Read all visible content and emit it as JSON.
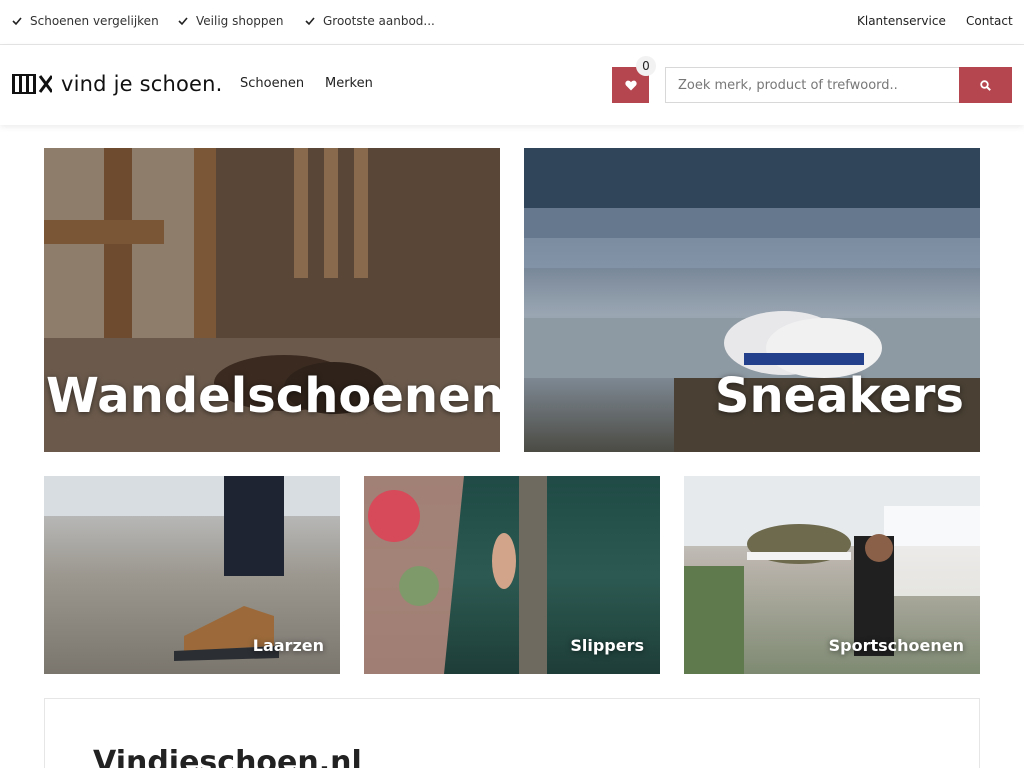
{
  "topbar": {
    "usps": [
      "Schoenen vergelijken",
      "Veilig shoppen",
      "Grootste aanbod..."
    ],
    "links": [
      "Klantenservice",
      "Contact"
    ]
  },
  "header": {
    "logo_text": "vind je schoen.",
    "nav": [
      "Schoenen",
      "Merken"
    ],
    "wishlist_count": "0",
    "search_placeholder": "Zoek merk, product of trefwoord..",
    "accent_color": "#b5454f"
  },
  "categories": {
    "big": [
      {
        "label": "Wandelschoenen"
      },
      {
        "label": "Sneakers"
      }
    ],
    "small": [
      {
        "label": "Laarzen"
      },
      {
        "label": "Slippers"
      },
      {
        "label": "Sportschoenen"
      }
    ]
  },
  "intro": {
    "title": "Vindjeschoen.nl"
  }
}
